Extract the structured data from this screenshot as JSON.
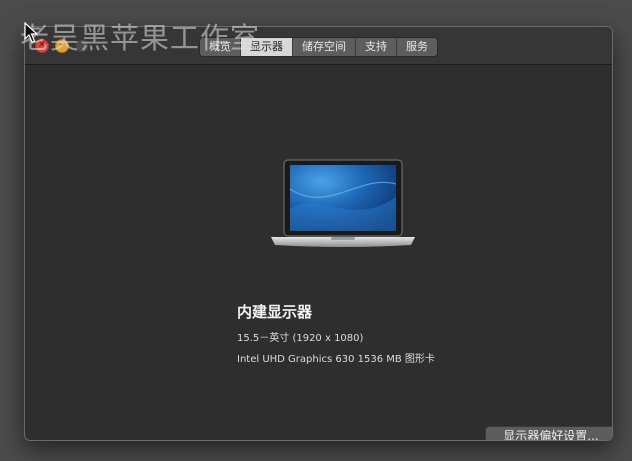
{
  "window": {
    "tabs": [
      {
        "label": "概览",
        "active": false
      },
      {
        "label": "显示器",
        "active": true
      },
      {
        "label": "储存空间",
        "active": false
      },
      {
        "label": "支持",
        "active": false
      },
      {
        "label": "服务",
        "active": false
      }
    ]
  },
  "watermark": "老吴黑苹果工作室",
  "display": {
    "name": "内建显示器",
    "size": "15.5－英寸 (1920 x 1080)",
    "graphics": "Intel UHD Graphics 630 1536 MB 图形卡"
  },
  "buttons": {
    "display_preferences": "显示器偏好设置..."
  },
  "icons": {
    "close": "close-icon",
    "minimize": "minimize-icon",
    "zoom": "zoom-icon",
    "laptop": "macbook-pro-icon",
    "cursor": "mouse-pointer-icon"
  },
  "colors": {
    "window_background": "#2e2e2f",
    "close": "#e0443e",
    "minimize": "#dea236",
    "active_tab": "#d8d8d8"
  }
}
